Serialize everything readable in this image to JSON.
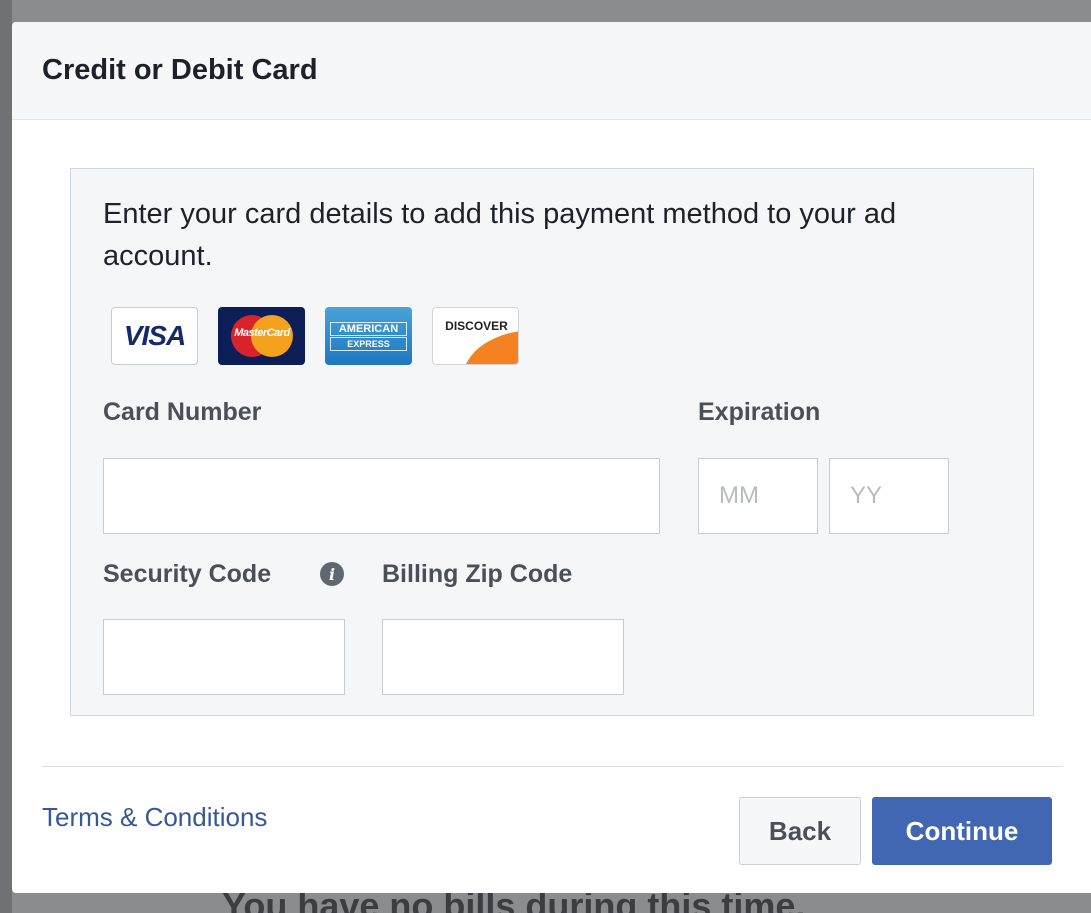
{
  "modal": {
    "title": "Credit or Debit Card"
  },
  "form": {
    "intro": "Enter your card details to add this payment method to your ad account.",
    "card_brands": [
      {
        "name": "visa",
        "label": "VISA"
      },
      {
        "name": "mastercard",
        "label": "MasterCard"
      },
      {
        "name": "amex",
        "label_1": "AMERICAN",
        "label_2": "EXPRESS"
      },
      {
        "name": "discover",
        "label": "DISCOVER"
      }
    ],
    "card_number": {
      "label": "Card Number",
      "value": "",
      "placeholder": ""
    },
    "expiration": {
      "label": "Expiration",
      "month": {
        "value": "",
        "placeholder": "MM"
      },
      "year": {
        "value": "",
        "placeholder": "YY"
      }
    },
    "security_code": {
      "label": "Security Code",
      "value": "",
      "placeholder": "",
      "info_icon": "info-icon"
    },
    "billing_zip": {
      "label": "Billing Zip Code",
      "value": "",
      "placeholder": ""
    }
  },
  "footer": {
    "terms_link": "Terms & Conditions",
    "back_label": "Back",
    "continue_label": "Continue"
  },
  "background": {
    "partial_text": "You have no bills during this time."
  },
  "colors": {
    "primary_button": "#4267b2",
    "link": "#365899",
    "panel_border": "#ccd6e8"
  }
}
